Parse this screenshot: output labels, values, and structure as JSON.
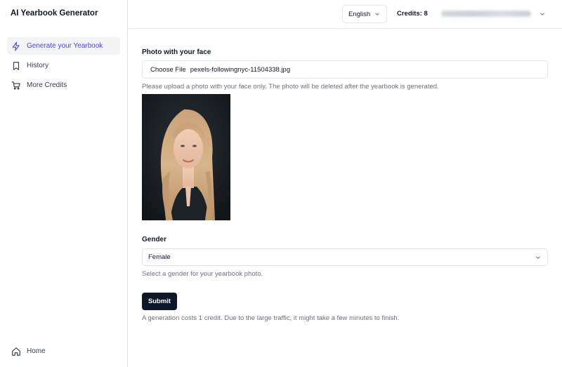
{
  "app": {
    "title": "AI Yearbook Generator"
  },
  "sidebar": {
    "items": [
      {
        "label": "Generate your Yearbook",
        "icon": "lightning-icon",
        "active": true
      },
      {
        "label": "History",
        "icon": "bookmark-icon",
        "active": false
      },
      {
        "label": "More Credits",
        "icon": "cart-icon",
        "active": false
      }
    ],
    "home": {
      "label": "Home",
      "icon": "home-icon"
    }
  },
  "topbar": {
    "language": "English",
    "credits": "Credits: 8",
    "account_email": "[blurred email address]"
  },
  "form": {
    "photo_label": "Photo with your face",
    "file_button": "Choose File",
    "file_name": "pexels-followingnyc-11504338.jpg",
    "photo_helper": "Please upload a photo with your face only. The photo will be deleted after the yearbook is generated.",
    "gender_label": "Gender",
    "gender_value": "Female",
    "gender_helper": "Select a gender for your yearbook photo.",
    "submit_label": "Submit",
    "submit_helper": "A generation costs 1 credit. Due to the large traffic, it might take a few minutes to finish."
  },
  "colors": {
    "accent": "#4f46e5",
    "button": "#0f172a",
    "border": "#e5e7eb",
    "muted_text": "#6b7280"
  }
}
